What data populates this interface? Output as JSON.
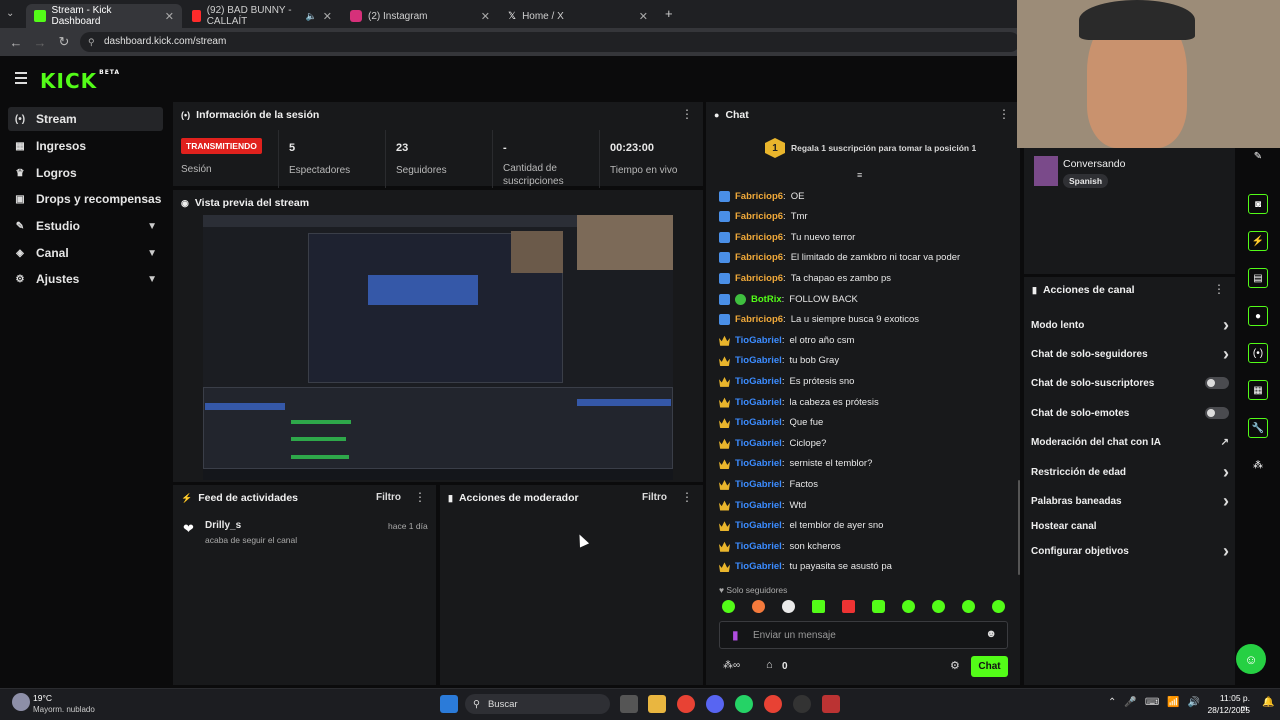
{
  "browser": {
    "tabs": [
      {
        "title": "Stream - Kick Dashboard",
        "active": true
      },
      {
        "title": "(92) BAD BUNNY - CALLAÍT",
        "active": false
      },
      {
        "title": "(2) Instagram",
        "active": false
      },
      {
        "title": "Home / X",
        "active": false
      }
    ],
    "url": "dashboard.kick.com/stream"
  },
  "app": {
    "logo": "KICK",
    "logo_tag": "BETA"
  },
  "sidebar": {
    "items": [
      {
        "label": "Stream",
        "icon": "broadcast-icon",
        "active": true
      },
      {
        "label": "Ingresos",
        "icon": "money-icon"
      },
      {
        "label": "Logros",
        "icon": "trophy-icon"
      },
      {
        "label": "Drops y recompensas",
        "icon": "gift-icon"
      },
      {
        "label": "Estudio",
        "icon": "studio-icon",
        "expandable": true
      },
      {
        "label": "Canal",
        "icon": "channel-icon",
        "expandable": true
      },
      {
        "label": "Ajustes",
        "icon": "gear-icon",
        "expandable": true
      }
    ]
  },
  "session": {
    "title": "Información de la sesión",
    "live_badge": "TRANSMITIENDO",
    "session_label": "Sesión",
    "stats": [
      {
        "value": "5",
        "label": "Espectadores"
      },
      {
        "value": "23",
        "label": "Seguidores"
      },
      {
        "value": "-",
        "label": "Cantidad de suscripciones"
      },
      {
        "value": "00:23:00",
        "label": "Tiempo en vivo"
      }
    ]
  },
  "preview": {
    "title": "Vista previa del stream"
  },
  "activity": {
    "title": "Feed de actividades",
    "filter": "Filtro",
    "items": [
      {
        "user": "Drilly_s",
        "action": "acaba de seguir el canal",
        "time": "hace 1 día"
      }
    ]
  },
  "mod_actions": {
    "title": "Acciones de moderador",
    "filter": "Filtro"
  },
  "chat": {
    "title": "Chat",
    "gift_rank": "1",
    "gift_text": "Regala 1 suscripción para tomar la posición 1",
    "messages": [
      {
        "user": "Fabriciop6",
        "text": "OE",
        "badges": [
          "mod"
        ],
        "color": "#f0a93a"
      },
      {
        "user": "Fabriciop6",
        "text": "Tmr",
        "badges": [
          "mod"
        ],
        "color": "#f0a93a"
      },
      {
        "user": "Fabriciop6",
        "text": "Tu nuevo terror",
        "badges": [
          "mod"
        ],
        "color": "#f0a93a"
      },
      {
        "user": "Fabriciop6",
        "text": "El limitado de zamkbro ni tocar va poder",
        "badges": [
          "mod"
        ],
        "color": "#f0a93a"
      },
      {
        "user": "Fabriciop6",
        "text": "Ta chapao es zambo ps",
        "badges": [
          "mod"
        ],
        "color": "#f0a93a"
      },
      {
        "user": "BotRix",
        "text": "FOLLOW BACK",
        "badges": [
          "mod",
          "ver"
        ],
        "color": "#53fc18"
      },
      {
        "user": "Fabriciop6",
        "text": "La u siempre busca 9 exoticos",
        "badges": [
          "mod"
        ],
        "color": "#f0a93a"
      },
      {
        "user": "TioGabriel",
        "text": "el otro año csm",
        "badges": [
          "sub"
        ],
        "color": "#3c8cff"
      },
      {
        "user": "TioGabriel",
        "text": "tu bob Gray",
        "badges": [
          "sub"
        ],
        "color": "#3c8cff"
      },
      {
        "user": "TioGabriel",
        "text": "Es prótesis sno",
        "badges": [
          "sub"
        ],
        "color": "#3c8cff"
      },
      {
        "user": "TioGabriel",
        "text": "la cabeza es prótesis",
        "badges": [
          "sub"
        ],
        "color": "#3c8cff"
      },
      {
        "user": "TioGabriel",
        "text": "Que fue",
        "badges": [
          "sub"
        ],
        "color": "#3c8cff"
      },
      {
        "user": "TioGabriel",
        "text": "Ciclope?",
        "badges": [
          "sub"
        ],
        "color": "#3c8cff"
      },
      {
        "user": "TioGabriel",
        "text": "serniste el temblor?",
        "badges": [
          "sub"
        ],
        "color": "#3c8cff"
      },
      {
        "user": "TioGabriel",
        "text": "Factos",
        "badges": [
          "sub"
        ],
        "color": "#3c8cff"
      },
      {
        "user": "TioGabriel",
        "text": "Wtd",
        "badges": [
          "sub"
        ],
        "color": "#3c8cff"
      },
      {
        "user": "TioGabriel",
        "text": "el temblor de ayer sno",
        "badges": [
          "sub"
        ],
        "color": "#3c8cff"
      },
      {
        "user": "TioGabriel",
        "text": "son kcheros",
        "badges": [
          "sub"
        ],
        "color": "#3c8cff"
      },
      {
        "user": "TioGabriel",
        "text": "tu payasita se asustó pa",
        "badges": [
          "sub"
        ],
        "color": "#3c8cff"
      }
    ],
    "followers_only": "Solo seguidores",
    "input_placeholder": "Enviar un mensaje",
    "viewers_count": "0",
    "send_label": "Chat"
  },
  "category": {
    "name": "Conversando",
    "language": "Spanish"
  },
  "channel_actions": {
    "title": "Acciones de canal",
    "items": [
      {
        "label": "Modo lento",
        "control": "chevron"
      },
      {
        "label": "Chat de solo-seguidores",
        "control": "chevron"
      },
      {
        "label": "Chat de solo-suscriptores",
        "control": "toggle"
      },
      {
        "label": "Chat de solo-emotes",
        "control": "toggle"
      },
      {
        "label": "Moderación del chat con IA",
        "control": "external"
      },
      {
        "label": "Restricción de edad",
        "control": "chevron"
      },
      {
        "label": "Palabras baneadas",
        "control": "chevron"
      },
      {
        "label": "Hostear canal",
        "control": "none"
      },
      {
        "label": "Configurar objetivos",
        "control": "chevron"
      }
    ]
  },
  "taskbar": {
    "weather_temp": "19°C",
    "weather_desc": "Mayorm. nublado",
    "search": "Buscar",
    "time": "11:05 p. m.",
    "date": "28/12/2025"
  },
  "colors": {
    "accent": "#53fc18",
    "live": "#e0211d",
    "panel": "#18191b",
    "bg": "#0b0b0c"
  }
}
